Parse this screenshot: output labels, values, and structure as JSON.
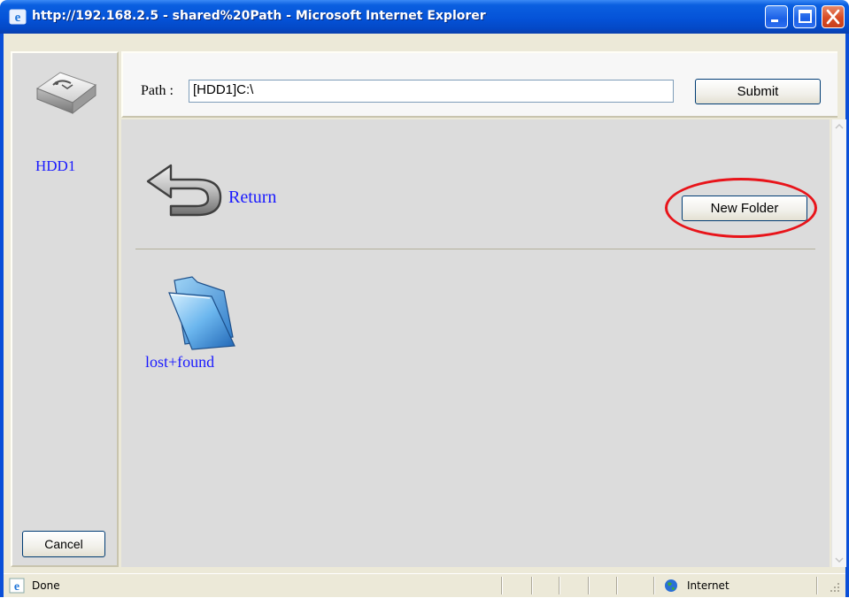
{
  "window": {
    "title": "http://192.168.2.5 - shared%20Path - Microsoft Internet Explorer",
    "controls": [
      "minimize-icon",
      "maximize-icon",
      "close-icon"
    ]
  },
  "sidebar": {
    "drive_icon": "usb-drive-icon",
    "drive_label": "HDD1",
    "cancel_label": "Cancel"
  },
  "pathbar": {
    "label": "Path :",
    "value": "[HDD1]C:\\",
    "submit_label": "Submit"
  },
  "main": {
    "return_icon": "return-arrow-icon",
    "return_label": "Return",
    "new_folder_label": "New Folder",
    "folders": [
      {
        "name": "lost+found",
        "icon": "folder-icon"
      }
    ]
  },
  "statusbar": {
    "status": "Done",
    "zone": "Internet"
  },
  "colors": {
    "link": "#1a1aff",
    "highlight": "#e8141a",
    "titlebar": "#0553d8"
  }
}
